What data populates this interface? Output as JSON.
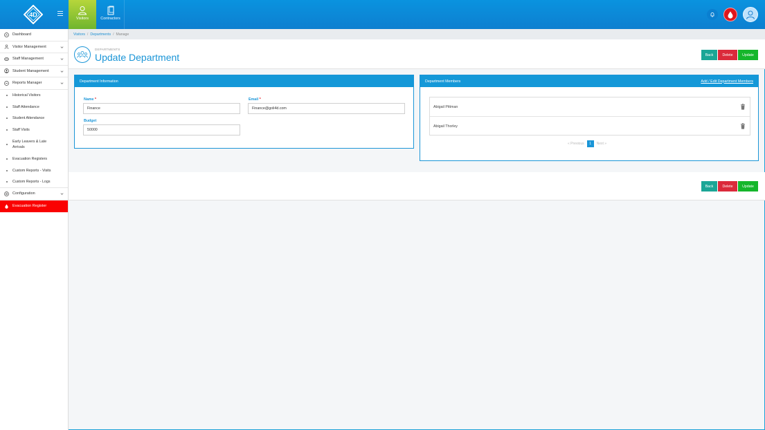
{
  "app": {
    "brand": "4D",
    "accent_color": "#1a95d7",
    "evacuation_color": "#fa0202"
  },
  "topnav": {
    "tabs": [
      {
        "label": "Visitors",
        "active": true,
        "icon": "person-icon"
      },
      {
        "label": "Contractors",
        "active": false,
        "icon": "clipboard-icon"
      }
    ],
    "icons": [
      "bell-icon",
      "evacuation-drop-icon",
      "user-avatar-icon"
    ]
  },
  "sidebar": {
    "items": [
      {
        "label": "Dashboard",
        "icon": "dashboard-icon"
      },
      {
        "label": "Visitor Management",
        "icon": "person-icon"
      },
      {
        "label": "Staff Management",
        "icon": "id-card-icon"
      },
      {
        "label": "Student Management",
        "icon": "student-icon"
      },
      {
        "label": "Reports Manager",
        "icon": "reports-icon"
      },
      {
        "label": "Configuration",
        "icon": "gear-icon"
      },
      {
        "label": "Evacuation Register",
        "icon": "drop-icon"
      }
    ],
    "reports": [
      "Historical Visitors",
      "Staff Attendance",
      "Student Attendance",
      "Staff Visits",
      "Early Leavers & Late Arrivals",
      "Evacuation Registers",
      "Custom Reports - Visits",
      "Custom Reports - Logs"
    ]
  },
  "breadcrumb": {
    "items": [
      "Visitors",
      "Departments",
      "Manage"
    ],
    "separator": "/"
  },
  "header": {
    "kicker": "DEPARTMENTS",
    "title": "Update Department"
  },
  "buttons": {
    "back": "Back",
    "delete": "Delete",
    "update": "Update"
  },
  "info_panel": {
    "title": "Department Information",
    "name_label": "Name",
    "name_value": "Finance",
    "email_label": "Email",
    "email_value": "Finance@goli4d.com",
    "budget_label": "Budget",
    "budget_value": "50000",
    "required_mark": "*"
  },
  "members_panel": {
    "title": "Department Members",
    "link": "Add / Edit Department Members",
    "members": [
      "Abigail Pittman",
      "Abigail Thorley"
    ],
    "pagination": {
      "prev": "« Previous",
      "page": "1",
      "next": "Next »"
    }
  }
}
